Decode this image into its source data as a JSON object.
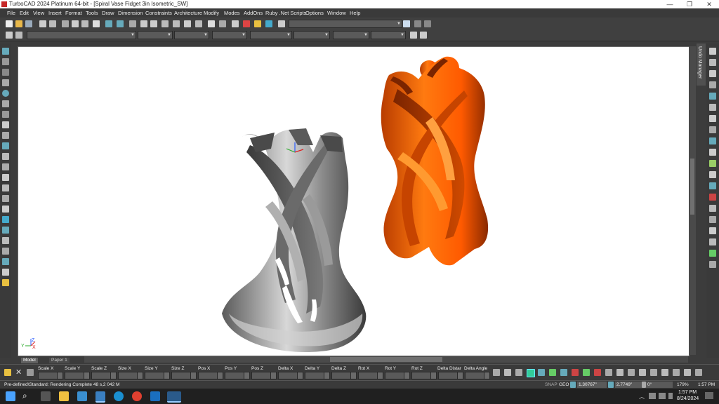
{
  "window": {
    "title": "TurboCAD 2024 Platinum 64-bit - [Spiral Vase Fidget 3in Isometric_SW]",
    "min_glyph": "—",
    "max_glyph": "❐",
    "close_glyph": "✕"
  },
  "menu": [
    "File",
    "Edit",
    "View",
    "Insert",
    "Format",
    "Tools",
    "Draw",
    "Dimension",
    "Constraints",
    "Architecture",
    "Modify",
    "Modes",
    "AddOns",
    "Ruby .Net Scripts",
    "Options",
    "Window",
    "Help"
  ],
  "panels": {
    "undo_manager": "Undo Manager"
  },
  "sheets": {
    "model": "Model",
    "paper": "Paper 1"
  },
  "coord_fields": [
    "Scale X",
    "Scale Y",
    "Scale Z",
    "Size X",
    "Size Y",
    "Size Z",
    "Pos X",
    "Pos Y",
    "Pos Z",
    "Delta X",
    "Delta Y",
    "Delta Z",
    "Rot X",
    "Rot Y",
    "Rot Z",
    "Delta Distance",
    "Delta Angle"
  ],
  "status": {
    "message": "Pre-defined\\Standard: Rendering Complete 48 s,2 042 M",
    "snap": "SNAP",
    "geo": "GEO",
    "x_value": "1.30767\"",
    "y_value": "2.7749\"",
    "angle_value": "0°",
    "zoom": "179%",
    "time": "1:57 PM"
  },
  "taskbar": {
    "time": "1:57 PM",
    "date": "8/24/2024"
  },
  "axis_labels": {
    "y": "Y",
    "x": "X",
    "z": "Z"
  },
  "colors": {
    "vase_gray": "#8a8a8a",
    "vase_orange": "#ff6a00",
    "chrome_dark": "#3a3a3a"
  }
}
